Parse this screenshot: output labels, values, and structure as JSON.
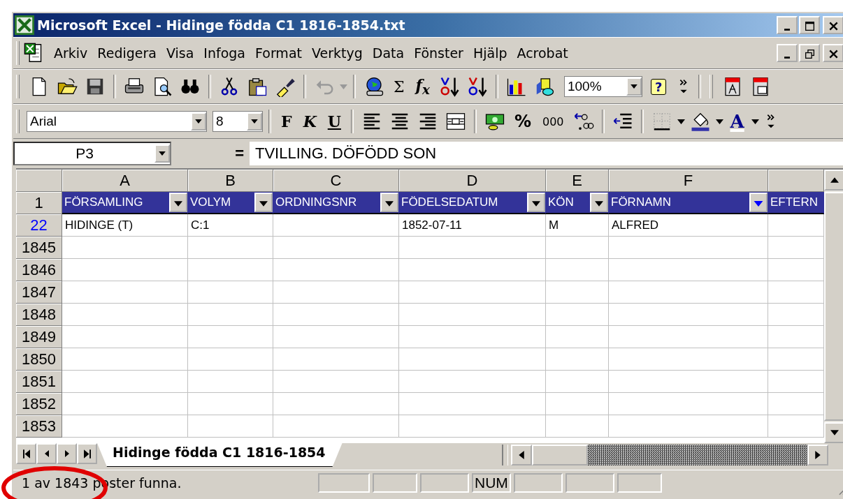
{
  "window": {
    "title": "Microsoft Excel - Hidinge födda C1 1816-1854.txt"
  },
  "menu": [
    "Arkiv",
    "Redigera",
    "Visa",
    "Infoga",
    "Format",
    "Verktyg",
    "Data",
    "Fönster",
    "Hjälp",
    "Acrobat"
  ],
  "standard_toolbar": {
    "sum_label": "Σ",
    "function_label": "f$_{x}$",
    "zoom": "100%",
    "help_label": "?"
  },
  "formatting_toolbar": {
    "font": "Arial",
    "size": "8",
    "bold_label": "F",
    "italic_label": "K",
    "underline_label": "U",
    "percent_label": "%",
    "thousands_label": "000",
    "font_color_label": "A"
  },
  "formula_bar": {
    "name_box": "P3",
    "equals": "=",
    "value": "TVILLING. DÖFÖDD SON"
  },
  "sheet": {
    "columns": [
      "A",
      "B",
      "C",
      "D",
      "E",
      "F"
    ],
    "header_row": {
      "number": "1",
      "cells": [
        {
          "label": "FÖRSAMLING",
          "filter": true,
          "filter_active": false
        },
        {
          "label": "VOLYM",
          "filter": true,
          "filter_active": false
        },
        {
          "label": "ORDNINGSNR",
          "filter": true,
          "filter_active": false
        },
        {
          "label": "FÖDELSEDATUM",
          "filter": true,
          "filter_active": false
        },
        {
          "label": "KÖN",
          "filter": true,
          "filter_active": false
        },
        {
          "label": "FÖRNAMN",
          "filter": true,
          "filter_active": true
        },
        {
          "label": "EFTERN"
        }
      ]
    },
    "rows": [
      {
        "number": "22",
        "filtered": true,
        "cells": [
          "HIDINGE (T)",
          "C:1",
          null,
          "1852-07-11",
          "M",
          "ALFRED",
          null
        ]
      },
      {
        "number": "1845",
        "filtered": false,
        "cells": []
      },
      {
        "number": "1846",
        "filtered": false,
        "cells": []
      },
      {
        "number": "1847",
        "filtered": false,
        "cells": []
      },
      {
        "number": "1848",
        "filtered": false,
        "cells": []
      },
      {
        "number": "1849",
        "filtered": false,
        "cells": []
      },
      {
        "number": "1850",
        "filtered": false,
        "cells": []
      },
      {
        "number": "1851",
        "filtered": false,
        "cells": []
      },
      {
        "number": "1852",
        "filtered": false,
        "cells": []
      },
      {
        "number": "1853",
        "filtered": false,
        "cells": []
      }
    ]
  },
  "sheet_tabs": [
    {
      "label": "Hidinge födda C1 1816-1854",
      "selected": true
    }
  ],
  "status_bar": {
    "message": "1 av 1843 poster funna.",
    "num_lock": "NUM"
  },
  "annotation": {
    "kind": "ellipse"
  }
}
